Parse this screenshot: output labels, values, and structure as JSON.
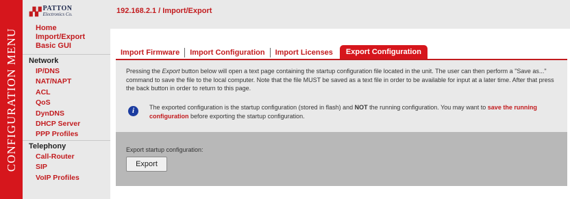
{
  "vertical_banner": "CONFIGURATION MENU",
  "logo": {
    "mark": "⬛⬛",
    "name": "PATTON",
    "sub": "Electronics Co."
  },
  "breadcrumb": "192.168.2.1 / Import/Export",
  "nav": {
    "top_links": [
      "Home",
      "Import/Export",
      "Basic GUI"
    ],
    "network": {
      "heading": "Network",
      "items": [
        "IP/DNS",
        "NAT/NAPT",
        "ACL",
        "QoS",
        "DynDNS",
        "DHCP Server",
        "PPP Profiles"
      ]
    },
    "telephony": {
      "heading": "Telephony",
      "items": [
        "Call-Router",
        "SIP",
        "VoIP Profiles"
      ]
    }
  },
  "tabs": [
    "Import Firmware",
    "Import Configuration",
    "Import Licenses",
    "Export Configuration"
  ],
  "active_tab": "Export Configuration",
  "description": {
    "part1": "Pressing the ",
    "emphasis": "Export",
    "part2": " button below will open a text page containing the startup configuration file located in the unit. The user can then perform a \"Save as...\" command to save the file to the local computer. Note that the file MUST be saved as a text file in order to be available for input at a later time. After that press the back button in order to return to this page."
  },
  "info": {
    "icon": "info-icon",
    "part1": "The exported configuration is the startup configuration (stored in flash) and ",
    "bold": "NOT",
    "part2": " the running configuration. You may want to ",
    "link": "save the running configuration",
    "part3": " before exporting the startup configuration."
  },
  "export": {
    "label": "Export startup configuration:",
    "button": "Export"
  },
  "colors": {
    "brand_red": "#d6161c",
    "link_red": "#c21b1e",
    "panel_gray": "#e9e9e9",
    "export_panel_gray": "#b8b8b8",
    "info_blue": "#1b3ca0"
  }
}
